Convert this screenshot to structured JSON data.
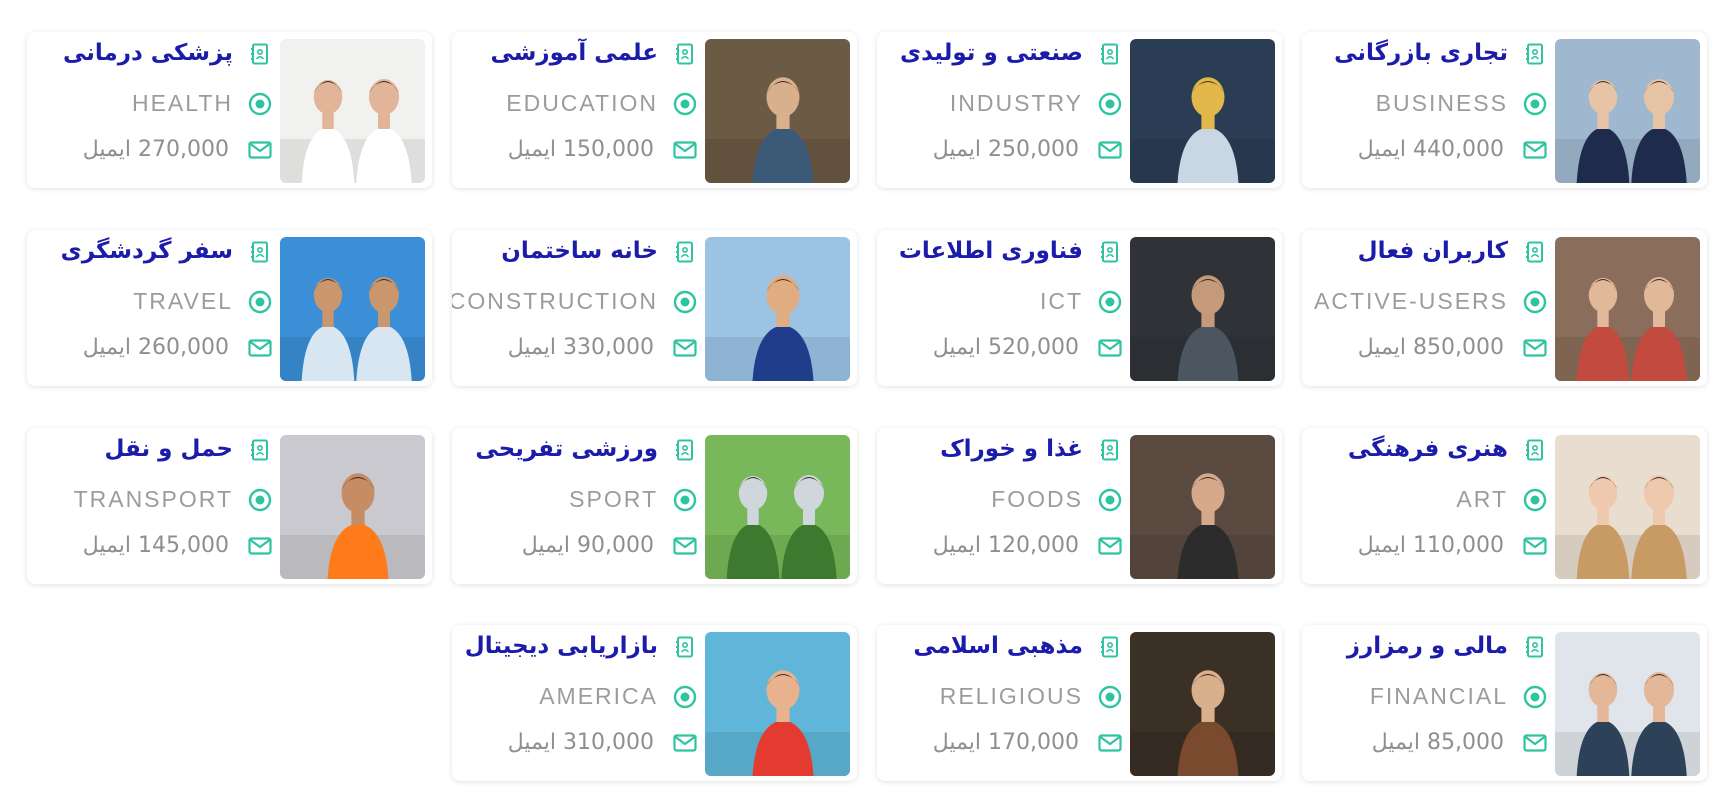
{
  "colors": {
    "title": "#1c1cab",
    "accent": "#2ec4a0",
    "muted": "#9c9c9c"
  },
  "icons": {
    "title": "contact-book-icon",
    "code": "radio-dot-icon",
    "count": "envelope-icon"
  },
  "cards": [
    {
      "fa": "تجاری بازرگانی",
      "en": "BUSINESS",
      "count": "440,000 ایمیل"
    },
    {
      "fa": "صنعتی و تولیدی",
      "en": "INDUSTRY",
      "count": "250,000 ایمیل"
    },
    {
      "fa": "علمی آموزشی",
      "en": "EDUCATION",
      "count": "150,000 ایمیل"
    },
    {
      "fa": "پزشکی درمانی",
      "en": "HEALTH",
      "count": "270,000 ایمیل"
    },
    {
      "fa": "کاربران فعال",
      "en": "ACTIVE-USERS",
      "count": "850,000 ایمیل"
    },
    {
      "fa": "فناوری اطلاعات",
      "en": "ICT",
      "count": "520,000 ایمیل"
    },
    {
      "fa": "خانه ساختمان",
      "en": "CONSTRUCTION",
      "count": "330,000 ایمیل"
    },
    {
      "fa": "سفر گردشگری",
      "en": "TRAVEL",
      "count": "260,000 ایمیل"
    },
    {
      "fa": "هنری فرهنگی",
      "en": "ART",
      "count": "110,000 ایمیل"
    },
    {
      "fa": "غذا و خوراک",
      "en": "FOODS",
      "count": "120,000 ایمیل"
    },
    {
      "fa": "ورزشی تفریحی",
      "en": "SPORT",
      "count": "90,000 ایمیل"
    },
    {
      "fa": "حمل و نقل",
      "en": "TRANSPORT",
      "count": "145,000 ایمیل"
    },
    {
      "fa": "مالی و رمزارز",
      "en": "FINANCIAL",
      "count": "85,000 ایمیل"
    },
    {
      "fa": "مذهبی اسلامی",
      "en": "RELIGIOUS",
      "count": "170,000 ایمیل"
    },
    {
      "fa": "بازاریابی دیجیتال",
      "en": "AMERICA",
      "count": "310,000 ایمیل"
    }
  ]
}
